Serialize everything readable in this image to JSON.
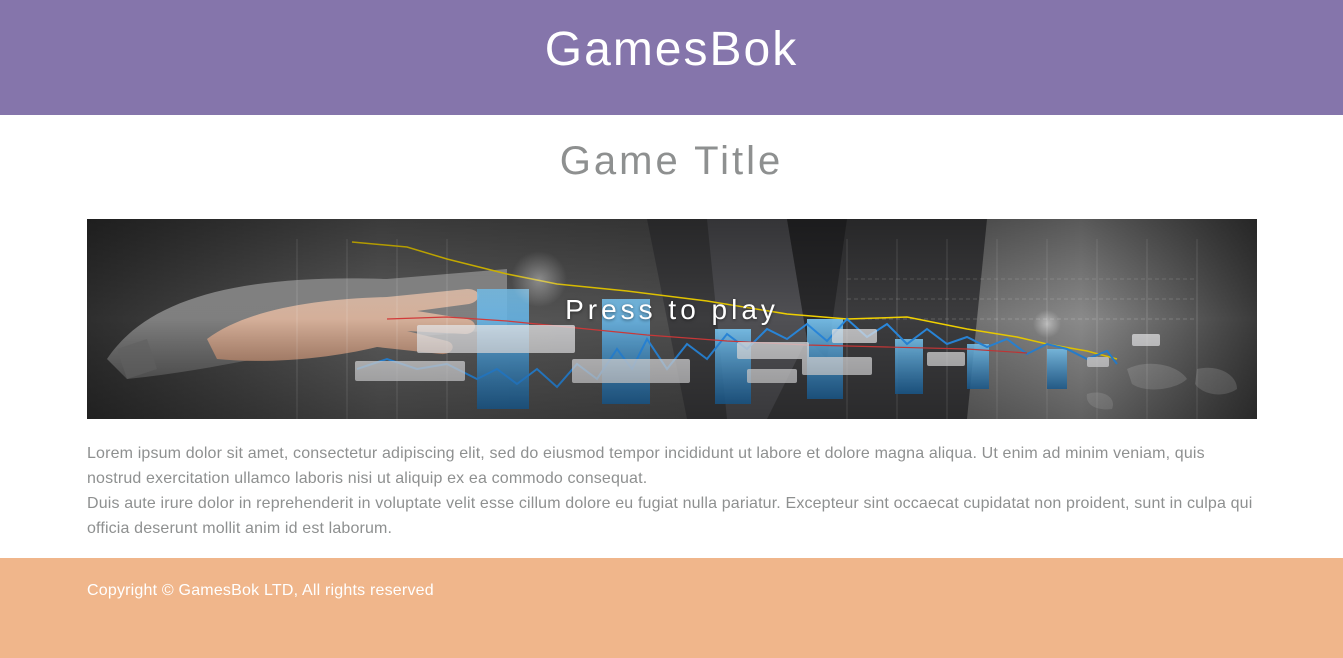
{
  "header": {
    "site_title": "GamesBok"
  },
  "main": {
    "game_title": "Game Title",
    "banner": {
      "play_label": "Press to play"
    },
    "paragraphs": [
      "Lorem ipsum dolor sit amet, consectetur adipiscing elit, sed do eiusmod tempor incididunt ut labore et dolore magna aliqua. Ut enim ad minim veniam, quis nostrud exercitation ullamco laboris nisi ut aliquip ex ea commodo consequat.",
      "Duis aute irure dolor in reprehenderit in voluptate velit esse cillum dolore eu fugiat nulla pariatur. Excepteur sint occaecat cupidatat non proident, sunt in culpa qui officia deserunt mollit anim id est laborum."
    ]
  },
  "footer": {
    "copyright": "Copyright © GamesBok LTD, All rights reserved"
  },
  "colors": {
    "header_bg": "#8575ab",
    "footer_bg": "#f0b68b",
    "title_gray": "#8e9090",
    "text_gray": "#8e9090",
    "white": "#ffffff"
  },
  "icons": [
    "banner-image"
  ]
}
